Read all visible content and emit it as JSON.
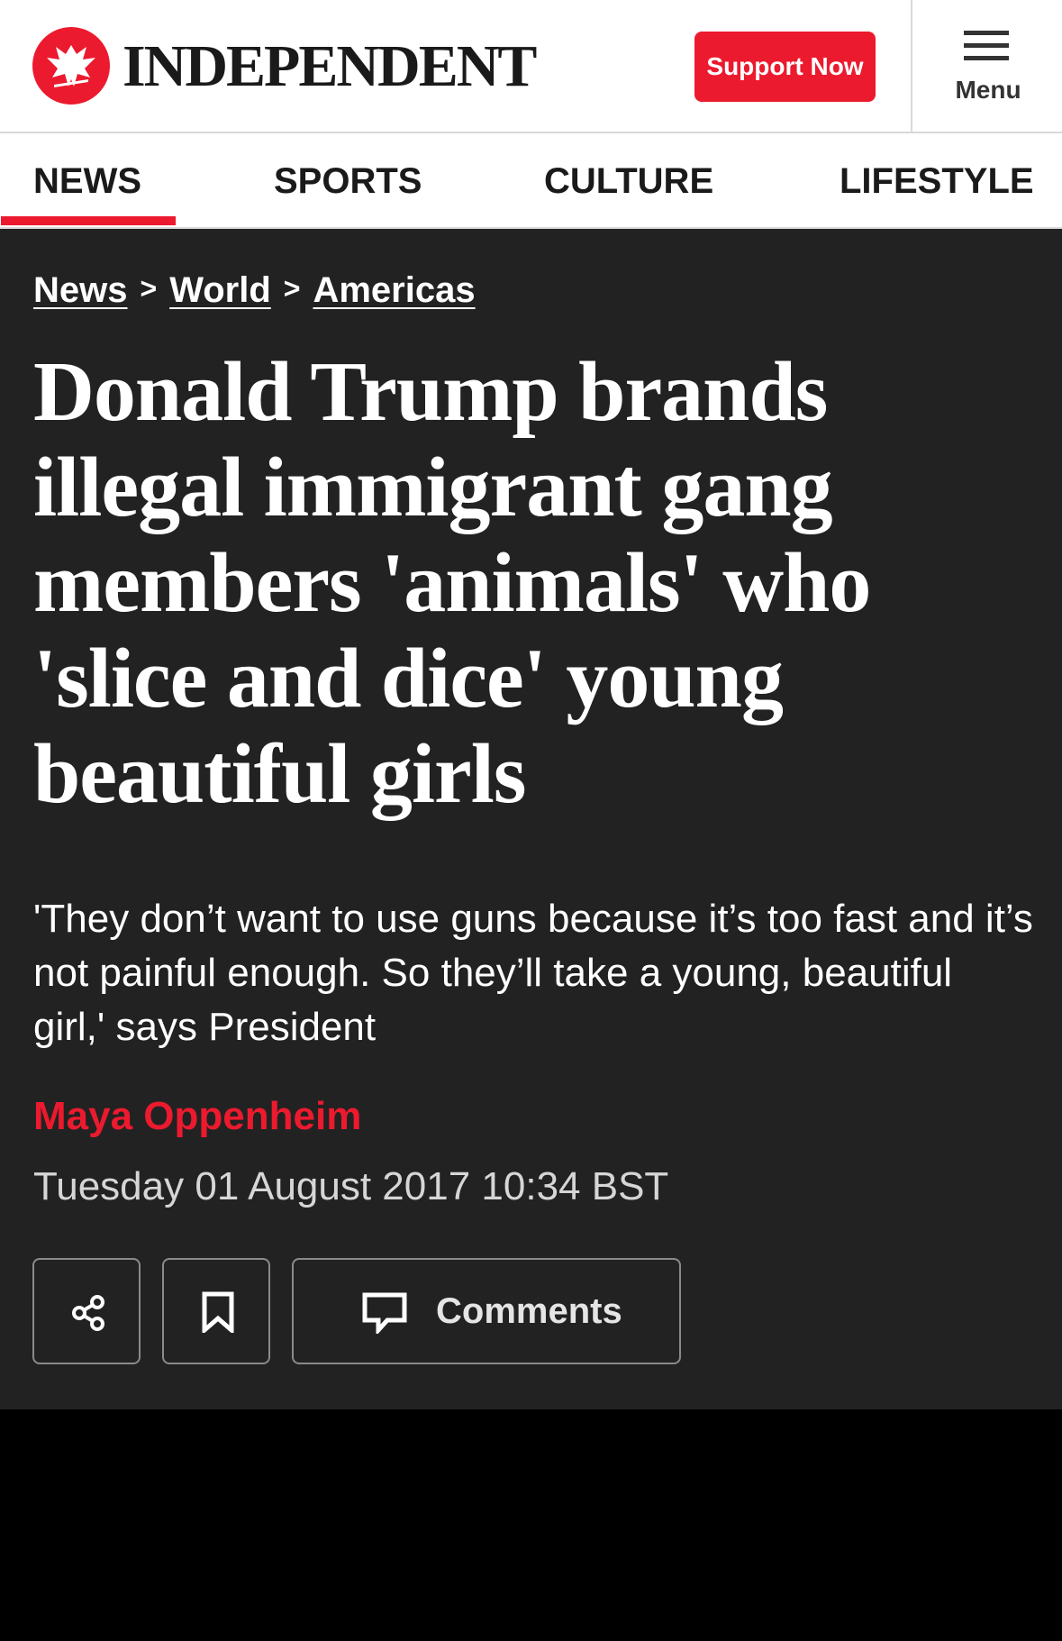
{
  "header": {
    "logo_text": "INDEPENDENT",
    "support_button": "Support Now",
    "menu_label": "Menu"
  },
  "nav": {
    "tabs": [
      {
        "label": "NEWS",
        "active": true
      },
      {
        "label": "SPORTS",
        "active": false
      },
      {
        "label": "CULTURE",
        "active": false
      },
      {
        "label": "LIFESTYLE",
        "active": false
      }
    ]
  },
  "breadcrumb": {
    "items": [
      "News",
      "World",
      "Americas"
    ],
    "separator": ">"
  },
  "article": {
    "headline": "Donald Trump brands illegal immigrant gang members 'animals' who 'slice and dice' young beautiful girls",
    "standfirst": "'They don’t want to use guns because it’s too fast and it’s not painful enough. So they’ll take a young, beautiful girl,' says President",
    "author": "Maya Oppenheim",
    "date": "Tuesday 01 August 2017 10:34 BST"
  },
  "actions": {
    "share_icon": "share-icon",
    "bookmark_icon": "bookmark-icon",
    "comments_icon": "comment-icon",
    "comments_label": "Comments"
  },
  "colors": {
    "brand_red": "#ec1a2e",
    "article_bg": "#222222",
    "page_bg": "#000000"
  }
}
